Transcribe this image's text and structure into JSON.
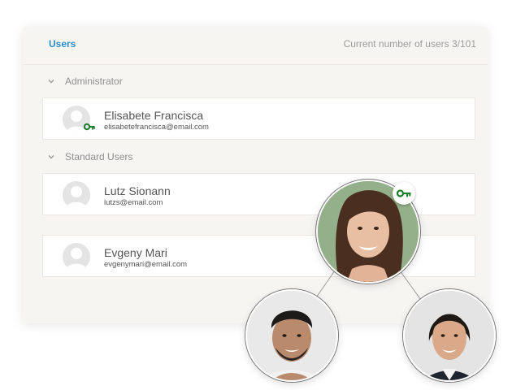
{
  "header": {
    "tab_label": "Users",
    "user_count_text": "Current number of users 3/101"
  },
  "sections": [
    {
      "title": "Administrator",
      "users": [
        {
          "name": "Elisabete Francisca",
          "email": "elisabetefrancisca@email.com",
          "has_key": true
        }
      ]
    },
    {
      "title": "Standard Users",
      "users": [
        {
          "name": "Lutz Sionann",
          "email": "lutzs@email.com"
        },
        {
          "name": "Evgeny Mari",
          "email": "evgenymari@email.com"
        }
      ]
    }
  ],
  "colors": {
    "accent": "#2a8fc9",
    "key": "#1a7f2b",
    "panel_bg": "#f7f5f2"
  },
  "icons": {
    "section_toggle": "chevron-down-icon",
    "admin_badge": "key-icon",
    "avatar_placeholder": "user-avatar-icon"
  }
}
